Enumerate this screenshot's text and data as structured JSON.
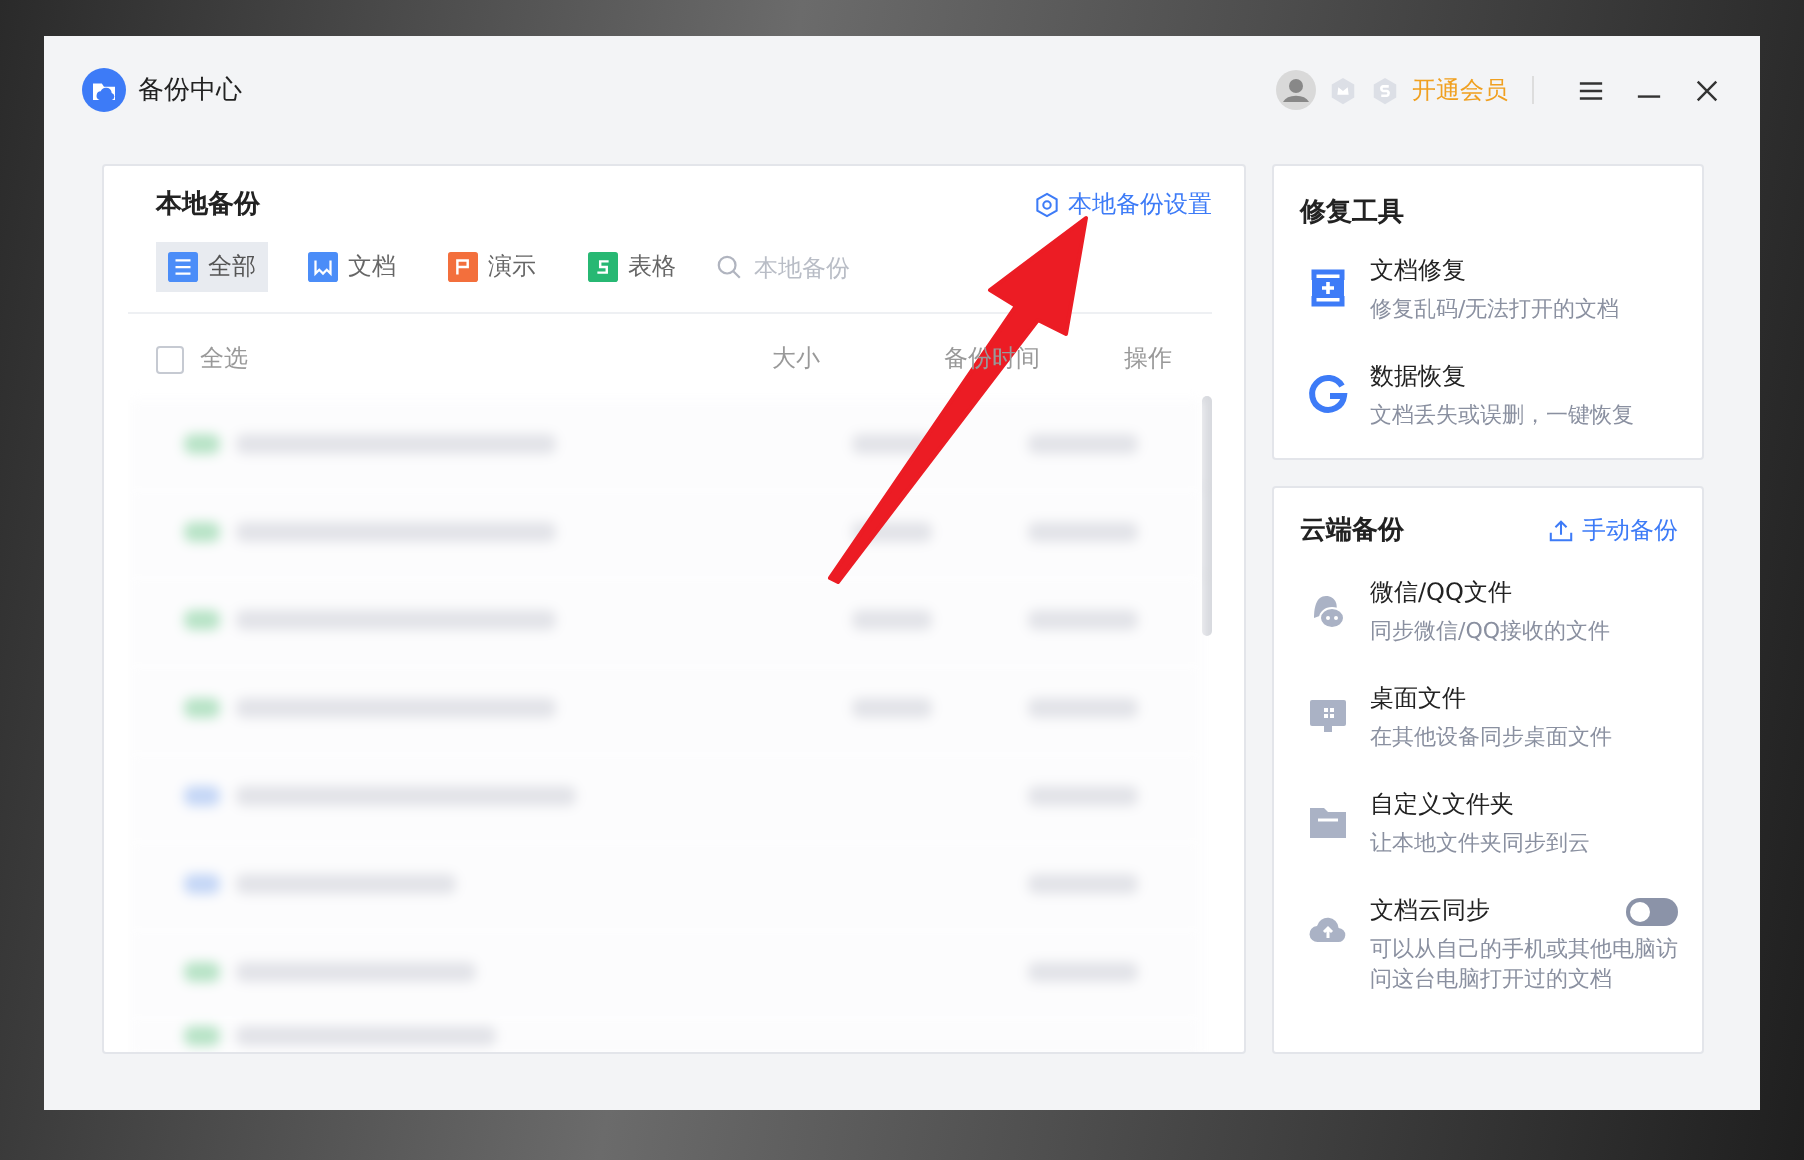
{
  "window": {
    "title": "备份中心",
    "vip_label": "开通会员"
  },
  "local_backup": {
    "title": "本地备份",
    "settings_link": "本地备份设置",
    "tabs": [
      {
        "kind": "all",
        "label": "全部",
        "selected": true
      },
      {
        "kind": "word",
        "label": "文档",
        "selected": false
      },
      {
        "kind": "ppt",
        "label": "演示",
        "selected": false
      },
      {
        "kind": "sheet",
        "label": "表格",
        "selected": false
      }
    ],
    "search": {
      "placeholder": "本地备份"
    },
    "select_all": {
      "label": "全选",
      "checked": false
    },
    "columns": [
      "大小",
      "备份时间",
      "操作"
    ]
  },
  "repair_tools": {
    "title": "修复工具",
    "items": [
      {
        "kind": "doc-repair",
        "title": "文档修复",
        "desc": "修复乱码/无法打开的文档"
      },
      {
        "kind": "data-recovery",
        "title": "数据恢复",
        "desc": "文档丢失或误删，一键恢复"
      }
    ]
  },
  "cloud_backup": {
    "title": "云端备份",
    "manual_button": "手动备份",
    "items": [
      {
        "kind": "chat",
        "title": "微信/QQ文件",
        "desc": "同步微信/QQ接收的文件"
      },
      {
        "kind": "desktop",
        "title": "桌面文件",
        "desc": "在其他设备同步桌面文件"
      },
      {
        "kind": "folder",
        "title": "自定义文件夹",
        "desc": "让本地文件夹同步到云"
      },
      {
        "kind": "cloud",
        "title": "文档云同步",
        "desc": "可以从自己的手机或其他电脑访问这台电脑打开过的文档",
        "toggle": {
          "on": false
        }
      }
    ]
  }
}
